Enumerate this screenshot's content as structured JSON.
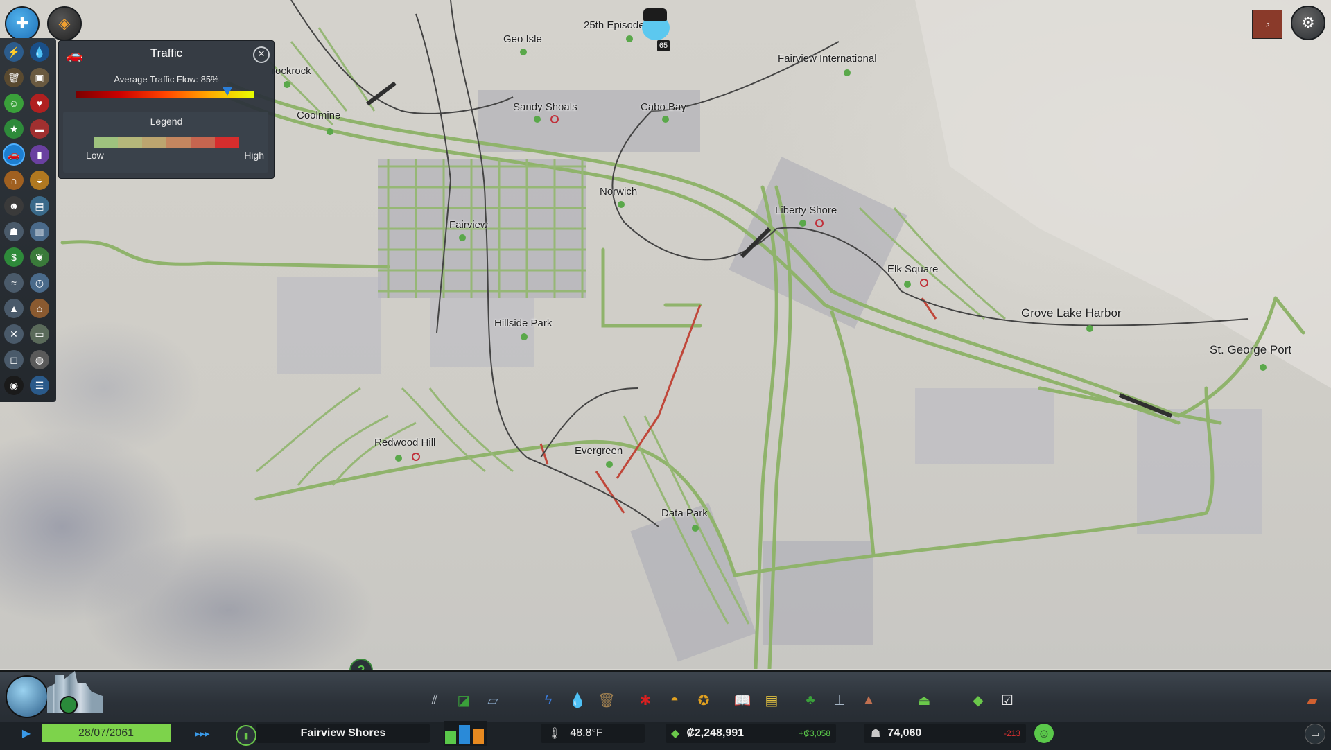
{
  "traffic_panel": {
    "title": "Traffic",
    "flow_label": "Average Traffic Flow: 85%",
    "flow_value": 85,
    "legend_title": "Legend",
    "legend_low": "Low",
    "legend_high": "High",
    "legend_colors": [
      "#9ec27e",
      "#b5b77a",
      "#bca56f",
      "#c4865f",
      "#c6654f",
      "#d62d2d"
    ]
  },
  "places": [
    {
      "name": "25th Episode"
    },
    {
      "name": "Geo Isle"
    },
    {
      "name": "Fairview International"
    },
    {
      "name": "rockrock"
    },
    {
      "name": "Coolmine"
    },
    {
      "name": "Sandy Shoals"
    },
    {
      "name": "Cabo Bay"
    },
    {
      "name": "Norwich"
    },
    {
      "name": "Fairview"
    },
    {
      "name": "Liberty Shore"
    },
    {
      "name": "Elk Square"
    },
    {
      "name": "Grove Lake Harbor"
    },
    {
      "name": "St. George Port"
    },
    {
      "name": "Hillside Park"
    },
    {
      "name": "Redwood Hill"
    },
    {
      "name": "Evergreen"
    },
    {
      "name": "Data Park"
    }
  ],
  "badge_count": "65",
  "bottom": {
    "date": "28/07/2061",
    "city_name": "Fairview Shores",
    "temperature": "48.8°F",
    "money": "₡2,248,991",
    "income": "+₡3,058",
    "population": "74,060",
    "population_change": "-213"
  },
  "colors": {
    "accent": "#2a7ed8",
    "road": "#8fb36b",
    "road_congested": "#c0473a",
    "panel_bg": "#2d343c",
    "date_bar": "#7dd34b"
  }
}
